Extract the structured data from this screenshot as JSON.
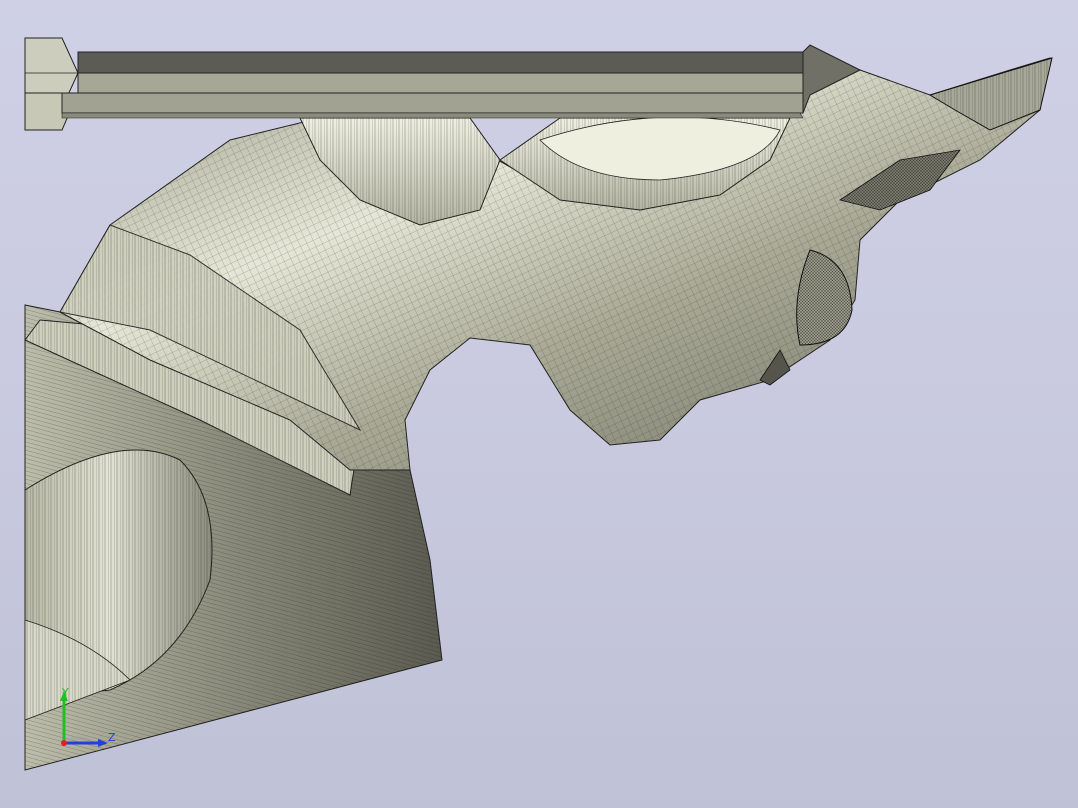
{
  "viewer": {
    "background_top": "#cfd0e6",
    "background_bottom": "#bfc1d6",
    "model_color": "#c8c8b4",
    "mesh_color": "#1a1a1a"
  },
  "triad": {
    "y_label": "Y",
    "z_label": "Z",
    "x_color": "#e02020",
    "y_color": "#20c020",
    "z_color": "#2040e0"
  }
}
